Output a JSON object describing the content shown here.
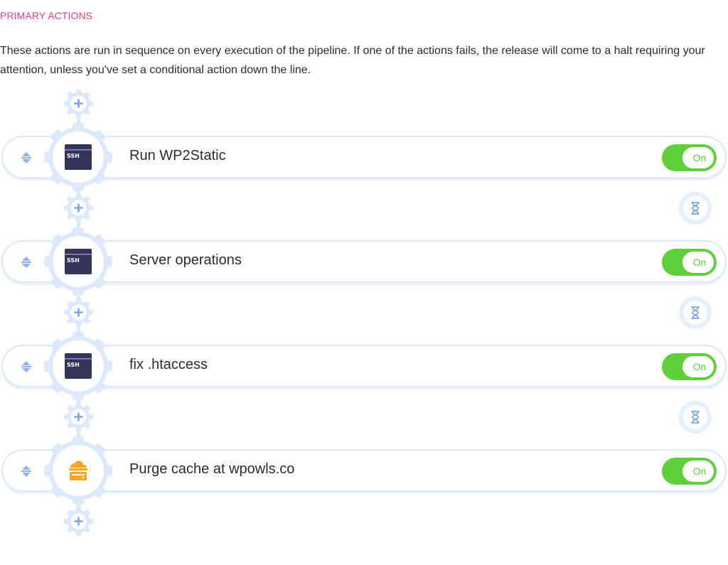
{
  "section": {
    "title": "PRIMARY ACTIONS",
    "description": "These actions are run in sequence on every execution of the pipeline. If one of the actions fails, the release will come to a halt requiring your attention, unless you've set a conditional action down the line."
  },
  "actions": [
    {
      "title": "Run WP2Static",
      "icon": "ssh-terminal-icon",
      "icon_text": "SSH",
      "toggle": "On",
      "enabled": true
    },
    {
      "title": "Server operations",
      "icon": "ssh-terminal-icon",
      "icon_text": "SSH",
      "toggle": "On",
      "enabled": true
    },
    {
      "title": "fix .htaccess",
      "icon": "ssh-terminal-icon",
      "icon_text": "SSH",
      "toggle": "On",
      "enabled": true
    },
    {
      "title": "Purge cache at wpowls.co",
      "icon": "cloudflare-cache-icon",
      "toggle": "On",
      "enabled": true
    }
  ],
  "colors": {
    "accent_pink": "#e83e8c",
    "toggle_green": "#5fcf3a",
    "border_blue": "#dbe9fb",
    "icon_dark": "#34345a",
    "cloud_orange": "#f5a623"
  }
}
